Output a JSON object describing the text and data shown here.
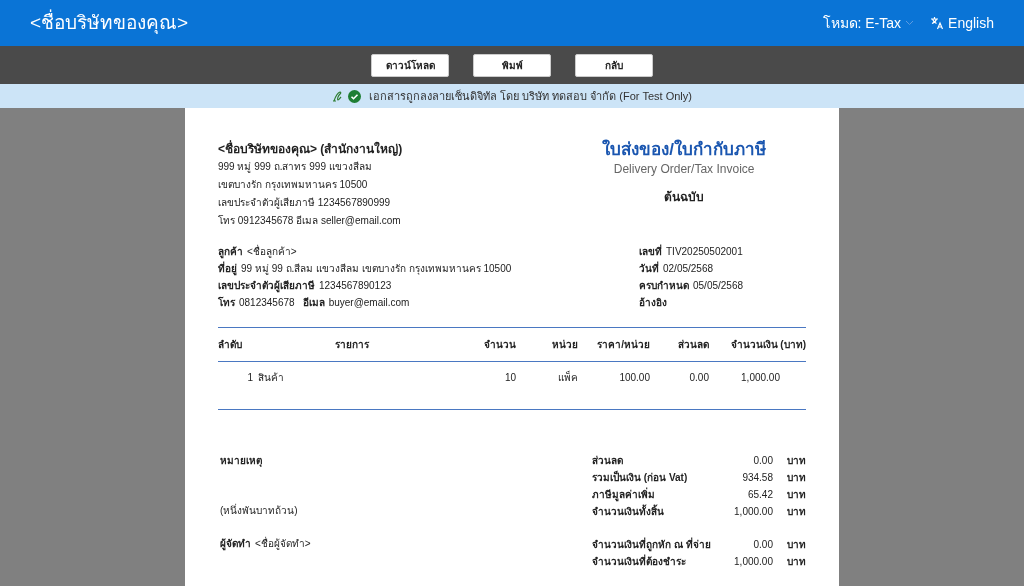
{
  "header": {
    "title": "<ชื่อบริษัทของคุณ>",
    "mode": "โหมด: E-Tax",
    "language": "English"
  },
  "toolbar": {
    "buttons": [
      "ดาวน์โหลด",
      "พิมพ์",
      "กลับ"
    ]
  },
  "signature": {
    "verified": true,
    "text": "เอกสารถูกลงลายเซ็นดิจิทัล โดย บริษัท ทดสอบ จำกัด (For Test Only)"
  },
  "document": {
    "seller": {
      "name": "<ชื่อบริษัทของคุณ> (สำนักงานใหญ่)",
      "lines": [
        "999 หมู่ 999 ถ.สาทร 999 แขวงสีลม",
        "เขตบางรัก  กรุงเทพมหานคร 10500",
        "เลขประจำตัวผู้เสียภาษี 1234567890999",
        "โทร 0912345678  อีเมล seller@email.com"
      ]
    },
    "title_th": "ใบส่งของ/ใบกำกับภาษี",
    "title_en": "Delivery Order/Tax Invoice",
    "copy_label": "ต้นฉบับ",
    "customer": [
      [
        {
          "label": "ลูกค้า",
          "value": "<ชื่อลูกค้า>"
        }
      ],
      [
        {
          "label": "ที่อยู่",
          "value": "99 หมู่ 99 ถ.สีลม แขวงสีลม เขตบางรัก กรุงเทพมหานคร 10500"
        }
      ],
      [
        {
          "label": "เลขประจำตัวผู้เสียภาษี",
          "value": "1234567890123"
        }
      ],
      [
        {
          "label": "โทร",
          "value": "0812345678"
        },
        {
          "label": "อีเมล",
          "value": "buyer@email.com"
        }
      ]
    ],
    "doc_info": [
      {
        "label": "เลขที่",
        "value": "TIV20250502001"
      },
      {
        "label": "วันที่",
        "value": "02/05/2568"
      },
      {
        "label": "ครบกำหนด",
        "value": "05/05/2568"
      },
      {
        "label": "อ้างอิง"
      }
    ],
    "table": {
      "columns": [
        "ลำดับ",
        "รายการ",
        "จำนวน",
        "หน่วย",
        "ราคา/หน่วย",
        "ส่วนลด",
        "จำนวนเงิน (บาท)"
      ],
      "rows": [
        [
          "1",
          "สินค้า",
          "10",
          "แพ็ค",
          "100.00",
          "0.00",
          "1,000.00"
        ]
      ]
    },
    "remark_label": "หมายเหตุ",
    "amount_words": "(หนึ่งพันบาทถ้วน)",
    "preparer": {
      "label": "ผู้จัดทำ",
      "value": "<ชื่อผู้จัดทำ>"
    },
    "totals": [
      {
        "label": "ส่วนลด",
        "value": "0.00",
        "unit": "บาท"
      },
      {
        "label": "รวมเป็นเงิน (ก่อน Vat)",
        "value": "934.58",
        "unit": "บาท"
      },
      {
        "label": "ภาษีมูลค่าเพิ่ม",
        "value": "65.42",
        "unit": "บาท"
      },
      {
        "label": "จำนวนเงินทั้งสิ้น",
        "value": "1,000.00",
        "unit": "บาท"
      }
    ],
    "payments": [
      {
        "label": "จำนวนเงินที่ถูกหัก ณ ที่จ่าย",
        "value": "0.00",
        "unit": "บาท"
      },
      {
        "label": "จำนวนเงินที่ต้องชำระ",
        "value": "1,000.00",
        "unit": "บาท"
      }
    ]
  }
}
